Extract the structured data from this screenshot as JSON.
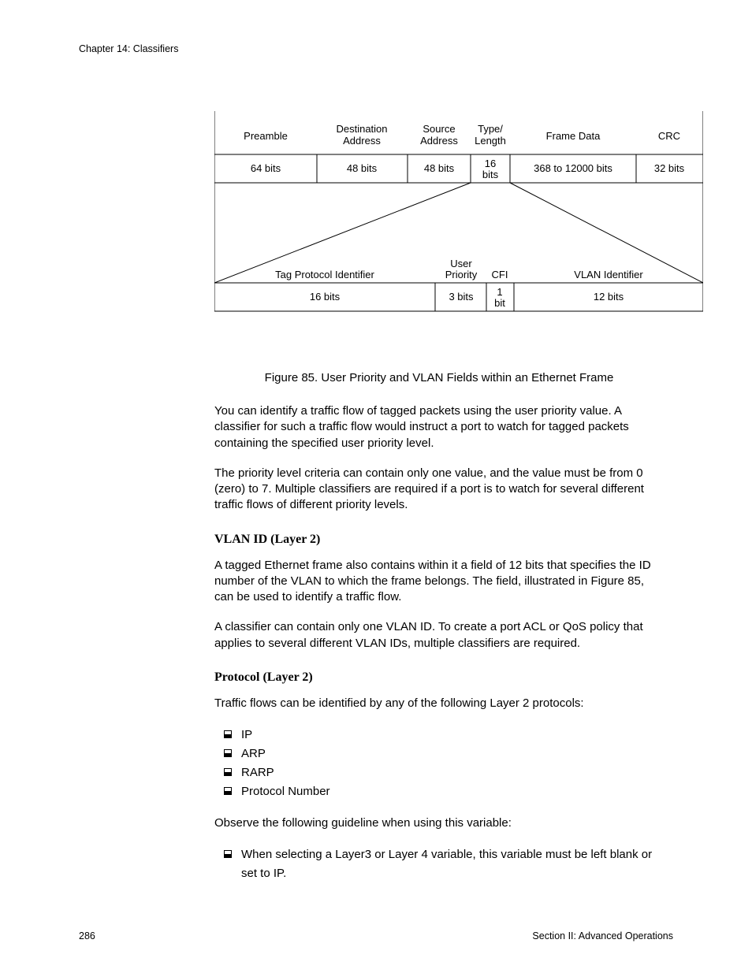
{
  "header": {
    "chapter": "Chapter 14: Classifiers"
  },
  "figure": {
    "top_labels": {
      "preamble": "Preamble",
      "dest": "Destination",
      "addr": "Address",
      "source": "Source",
      "type": "Type/",
      "length": "Length",
      "frame_data": "Frame Data",
      "crc": "CRC"
    },
    "top_values": {
      "preamble": "64 bits",
      "dest": "48 bits",
      "source": "48 bits",
      "tl1": "16",
      "tl2": "bits",
      "frame_data": "368 to 12000 bits",
      "crc": "32 bits"
    },
    "bottom_labels": {
      "tpi": "Tag Protocol Identifier",
      "user": "User",
      "priority": "Priority",
      "cfi": "CFI",
      "vlan_id": "VLAN Identifier"
    },
    "bottom_values": {
      "tpi": "16 bits",
      "priority": "3 bits",
      "cfi1": "1",
      "cfi2": "bit",
      "vlan_id": "12 bits"
    },
    "caption": "Figure 85. User Priority and VLAN Fields within an Ethernet Frame"
  },
  "body": {
    "p1": "You can identify a traffic flow of tagged packets using the user priority value. A classifier for such a traffic flow would instruct a port to watch for tagged packets containing the specified user priority level.",
    "p2": "The priority level criteria can contain only one value, and the value must be from 0 (zero) to 7. Multiple classifiers are required if a port is to watch for several different traffic flows of different priority levels.",
    "h1": "VLAN ID (Layer 2)",
    "p3": "A tagged Ethernet frame also contains within it a field of 12 bits that specifies the ID number of the VLAN to which the frame belongs. The field, illustrated in Figure 85, can be used to identify a traffic flow.",
    "p4": "A classifier can contain only one VLAN ID. To create a port ACL or QoS policy that applies to several different VLAN IDs, multiple classifiers are required.",
    "h2": "Protocol (Layer 2)",
    "p5": "Traffic flows can be identified by any of the following Layer 2 protocols:",
    "list": {
      "i1": "IP",
      "i2": "ARP",
      "i3": "RARP",
      "i4": "Protocol Number"
    },
    "p6": "Observe the following guideline when using this variable:",
    "list2": {
      "i1": "When selecting a Layer3 or Layer 4 variable, this variable must be left blank or set to IP."
    }
  },
  "footer": {
    "page": "286",
    "section": "Section II: Advanced Operations"
  }
}
